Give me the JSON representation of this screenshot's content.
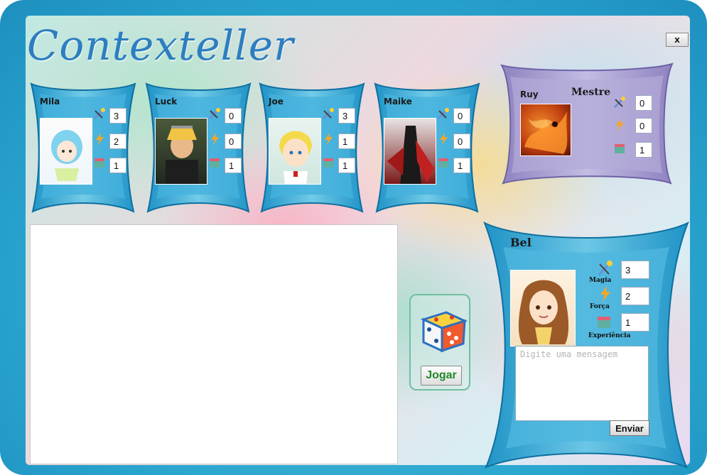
{
  "app": {
    "title": "Contexteller",
    "close_label": "x"
  },
  "players": [
    {
      "name": "Mila",
      "magia": "3",
      "forca": "2",
      "experiencia": "1"
    },
    {
      "name": "Luck",
      "magia": "0",
      "forca": "0",
      "experiencia": "1"
    },
    {
      "name": "Joe",
      "magia": "3",
      "forca": "1",
      "experiencia": "1"
    },
    {
      "name": "Maike",
      "magia": "0",
      "forca": "0",
      "experiencia": "1"
    }
  ],
  "master": {
    "name": "Ruy",
    "role_label": "Mestre",
    "magia": "0",
    "forca": "0",
    "experiencia": "1"
  },
  "me": {
    "name": "Bel",
    "magia": "3",
    "forca": "2",
    "experiencia": "1",
    "magia_label": "Magia",
    "forca_label": "Força",
    "experiencia_label": "Experiência"
  },
  "dice": {
    "button_label": "Jogar"
  },
  "chat": {
    "placeholder": "Digite uma mensagem",
    "send_label": "Enviar"
  },
  "colors": {
    "frame": "#2aa6cf",
    "title": "#2d7ec1",
    "card": "#2fa4d0",
    "master_card": "#9b8fc7",
    "jogar": "#1e8a2b"
  }
}
